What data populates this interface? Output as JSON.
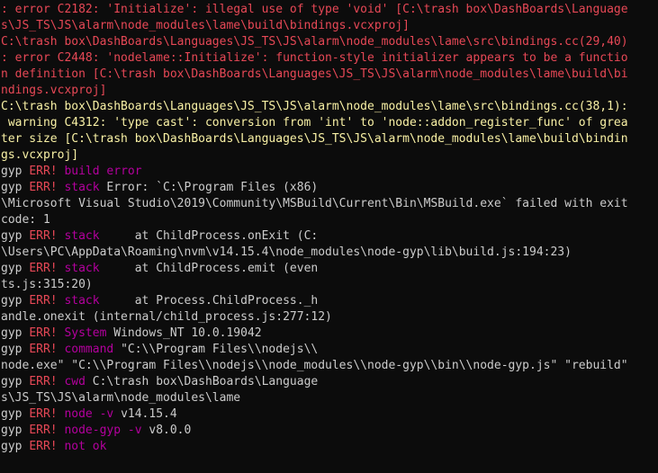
{
  "terminal": {
    "lines": [
      {
        "segments": [
          {
            "text": ": error C2182: 'Initialize': illegal use of type 'void' [C:\\trash box\\DashBoards\\Language",
            "color": "red"
          }
        ]
      },
      {
        "segments": [
          {
            "text": "s\\JS_TS\\JS\\alarm\\node_modules\\lame\\build\\bindings.vcxproj]",
            "color": "red"
          }
        ]
      },
      {
        "segments": [
          {
            "text": "C:\\trash box\\DashBoards\\Languages\\JS_TS\\JS\\alarm\\node_modules\\lame\\src\\bindings.cc(29,40)",
            "color": "red"
          }
        ]
      },
      {
        "segments": [
          {
            "text": ": error C2448: 'nodelame::Initialize': function-style initializer appears to be a functio",
            "color": "red"
          }
        ]
      },
      {
        "segments": [
          {
            "text": "n definition [C:\\trash box\\DashBoards\\Languages\\JS_TS\\JS\\alarm\\node_modules\\lame\\build\\bi",
            "color": "red"
          }
        ]
      },
      {
        "segments": [
          {
            "text": "ndings.vcxproj]",
            "color": "red"
          }
        ]
      },
      {
        "segments": [
          {
            "text": "C:\\trash box\\DashBoards\\Languages\\JS_TS\\JS\\alarm\\node_modules\\lame\\src\\bindings.cc(38,1):",
            "color": "yellow"
          }
        ]
      },
      {
        "segments": [
          {
            "text": " warning C4312: 'type cast': conversion from 'int' to 'node::addon_register_func' of grea",
            "color": "yellow"
          }
        ]
      },
      {
        "segments": [
          {
            "text": "ter size [C:\\trash box\\DashBoards\\Languages\\JS_TS\\JS\\alarm\\node_modules\\lame\\build\\bindin",
            "color": "yellow"
          }
        ]
      },
      {
        "segments": [
          {
            "text": "gs.vcxproj]",
            "color": "yellow"
          }
        ]
      },
      {
        "segments": [
          {
            "text": "gyp ",
            "color": "white"
          },
          {
            "text": "ERR!",
            "color": "err"
          },
          {
            "text": " build error",
            "color": "cmd"
          }
        ]
      },
      {
        "segments": [
          {
            "text": "gyp ",
            "color": "white"
          },
          {
            "text": "ERR!",
            "color": "err"
          },
          {
            "text": " stack",
            "color": "cmd"
          },
          {
            "text": " Error: `C:\\Program Files (x86)",
            "color": "white"
          }
        ]
      },
      {
        "segments": [
          {
            "text": "\\Microsoft Visual Studio\\2019\\Community\\MSBuild\\Current\\Bin\\MSBuild.exe` failed with exit",
            "color": "white"
          }
        ]
      },
      {
        "segments": [
          {
            "text": "code: 1",
            "color": "white"
          }
        ]
      },
      {
        "segments": [
          {
            "text": "gyp ",
            "color": "white"
          },
          {
            "text": "ERR!",
            "color": "err"
          },
          {
            "text": " stack",
            "color": "cmd"
          },
          {
            "text": "     at ChildProcess.onExit (C:",
            "color": "white"
          }
        ]
      },
      {
        "segments": [
          {
            "text": "\\Users\\PC\\AppData\\Roaming\\nvm\\v14.15.4\\node_modules\\node-gyp\\lib\\build.js:194:23)",
            "color": "white"
          }
        ]
      },
      {
        "segments": [
          {
            "text": "gyp ",
            "color": "white"
          },
          {
            "text": "ERR!",
            "color": "err"
          },
          {
            "text": " stack",
            "color": "cmd"
          },
          {
            "text": "     at ChildProcess.emit (even",
            "color": "white"
          }
        ]
      },
      {
        "segments": [
          {
            "text": "ts.js:315:20)",
            "color": "white"
          }
        ]
      },
      {
        "segments": [
          {
            "text": "gyp ",
            "color": "white"
          },
          {
            "text": "ERR!",
            "color": "err"
          },
          {
            "text": " stack",
            "color": "cmd"
          },
          {
            "text": "     at Process.ChildProcess._h",
            "color": "white"
          }
        ]
      },
      {
        "segments": [
          {
            "text": "andle.onexit (internal/child_process.js:277:12)",
            "color": "white"
          }
        ]
      },
      {
        "segments": [
          {
            "text": "gyp ",
            "color": "white"
          },
          {
            "text": "ERR!",
            "color": "err"
          },
          {
            "text": " System",
            "color": "cmd"
          },
          {
            "text": " Windows_NT 10.0.19042",
            "color": "white"
          }
        ]
      },
      {
        "segments": [
          {
            "text": "gyp ",
            "color": "white"
          },
          {
            "text": "ERR!",
            "color": "err"
          },
          {
            "text": " command",
            "color": "cmd"
          },
          {
            "text": " \"C:\\\\Program Files\\\\nodejs\\\\",
            "color": "white"
          }
        ]
      },
      {
        "segments": [
          {
            "text": "node.exe\" \"C:\\\\Program Files\\\\nodejs\\\\node_modules\\\\node-gyp\\\\bin\\\\node-gyp.js\" \"rebuild\"",
            "color": "white"
          }
        ]
      },
      {
        "segments": [
          {
            "text": "gyp ",
            "color": "white"
          },
          {
            "text": "ERR!",
            "color": "err"
          },
          {
            "text": " cwd",
            "color": "cmd"
          },
          {
            "text": " C:\\trash box\\DashBoards\\Language",
            "color": "white"
          }
        ]
      },
      {
        "segments": [
          {
            "text": "s\\JS_TS\\JS\\alarm\\node_modules\\lame",
            "color": "white"
          }
        ]
      },
      {
        "segments": [
          {
            "text": "gyp ",
            "color": "white"
          },
          {
            "text": "ERR!",
            "color": "err"
          },
          {
            "text": " node -v",
            "color": "cmd"
          },
          {
            "text": " v14.15.4",
            "color": "white"
          }
        ]
      },
      {
        "segments": [
          {
            "text": "gyp ",
            "color": "white"
          },
          {
            "text": "ERR!",
            "color": "err"
          },
          {
            "text": " node-gyp -v",
            "color": "cmd"
          },
          {
            "text": " v8.0.0",
            "color": "white"
          }
        ]
      },
      {
        "segments": [
          {
            "text": "gyp ",
            "color": "white"
          },
          {
            "text": "ERR!",
            "color": "err"
          },
          {
            "text": " not ok",
            "color": "cmd"
          }
        ]
      }
    ]
  },
  "colors": {
    "background": "#0c0c0c",
    "red": "#e74856",
    "yellow": "#f9f1a5",
    "white": "#cccccc",
    "magenta": "#b4009e"
  }
}
